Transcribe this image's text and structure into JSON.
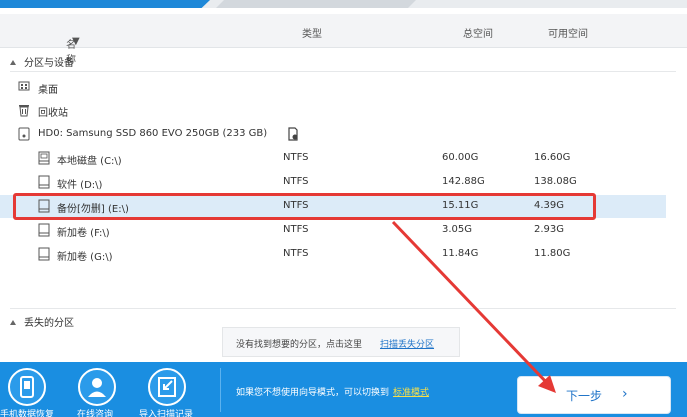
{
  "columns": {
    "name": "名称",
    "type": "类型",
    "total": "总空间",
    "free": "可用空间"
  },
  "section_devices": "分区与设备",
  "section_lost": "丢失的分区",
  "items": [
    {
      "label": "桌面",
      "icon": "desktop-icon"
    },
    {
      "label": "回收站",
      "icon": "recycle-bin-icon"
    },
    {
      "label": "HD0: Samsung SSD 860 EVO 250GB (233 GB)",
      "icon": "disk-icon"
    }
  ],
  "partitions": [
    {
      "label": "本地磁盘 (C:\\)",
      "type": "NTFS",
      "total": "60.00G",
      "free": "16.60G"
    },
    {
      "label": "软件 (D:\\)",
      "type": "NTFS",
      "total": "142.88G",
      "free": "138.08G"
    },
    {
      "label": "备份[勿删] (E:\\)",
      "type": "NTFS",
      "total": "15.11G",
      "free": "4.39G"
    },
    {
      "label": "新加卷 (F:\\)",
      "type": "NTFS",
      "total": "3.05G",
      "free": "2.93G"
    },
    {
      "label": "新加卷 (G:\\)",
      "type": "NTFS",
      "total": "11.84G",
      "free": "11.80G"
    }
  ],
  "scan": {
    "text": "没有找到想要的分区，点击这里",
    "link": "扫描丢失分区"
  },
  "bottom": {
    "buttons": [
      {
        "label": "手机数据恢复",
        "icon": "phone-icon"
      },
      {
        "label": "在线咨询",
        "icon": "user-support-icon"
      },
      {
        "label": "导入扫描记录",
        "icon": "import-icon"
      }
    ],
    "hint": "如果您不想使用向导模式，可以切换到",
    "hint_link": "标准模式",
    "next": "下一步",
    "next_chevron": "›"
  },
  "colors": {
    "accent": "#1a8ee1",
    "highlight": "#e53935",
    "selection": "#dcebf8"
  }
}
